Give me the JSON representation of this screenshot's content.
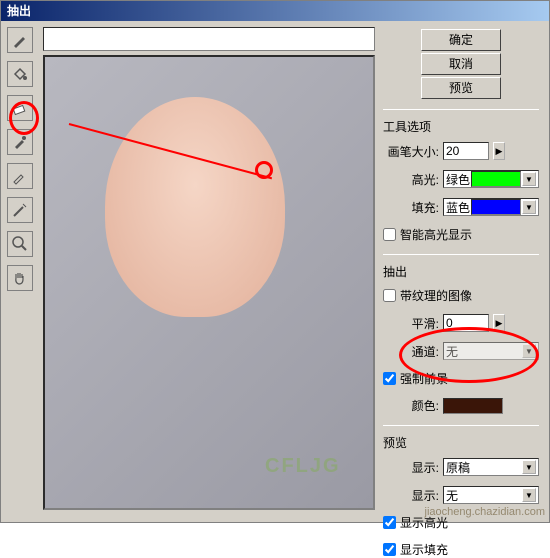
{
  "title": "抽出",
  "buttons": {
    "ok": "确定",
    "cancel": "取消",
    "preview": "预览"
  },
  "tools": {
    "title": "工具选项",
    "brush_label": "画笔大小:",
    "brush_size": "20",
    "highlight_label": "高光:",
    "highlight_value": "绿色",
    "fill_label": "填充:",
    "fill_value": "蓝色",
    "smart_hl": "智能高光显示"
  },
  "extract": {
    "title": "抽出",
    "textured": "带纹理的图像",
    "smooth_label": "平滑:",
    "smooth_value": "0",
    "channel_label": "通道:",
    "channel_value": "无",
    "force_fg": "强制前景",
    "color_label": "颜色:"
  },
  "preview": {
    "title": "预览",
    "show_label": "显示:",
    "show_value": "原稿",
    "display_label": "显示:",
    "display_value": "无",
    "show_hl": "显示高光",
    "show_fill": "显示填充"
  },
  "watermark": {
    "site": "jiaocheng.chazidian.com",
    "logo": "CFLJG"
  },
  "icons": {
    "marker": "marker-icon",
    "fill": "fill-icon",
    "eraser": "eraser-icon",
    "eyedropper": "eyedropper-icon",
    "cleanup": "cleanup-icon",
    "edge": "edge-icon",
    "zoom": "zoom-icon",
    "hand": "hand-icon"
  }
}
